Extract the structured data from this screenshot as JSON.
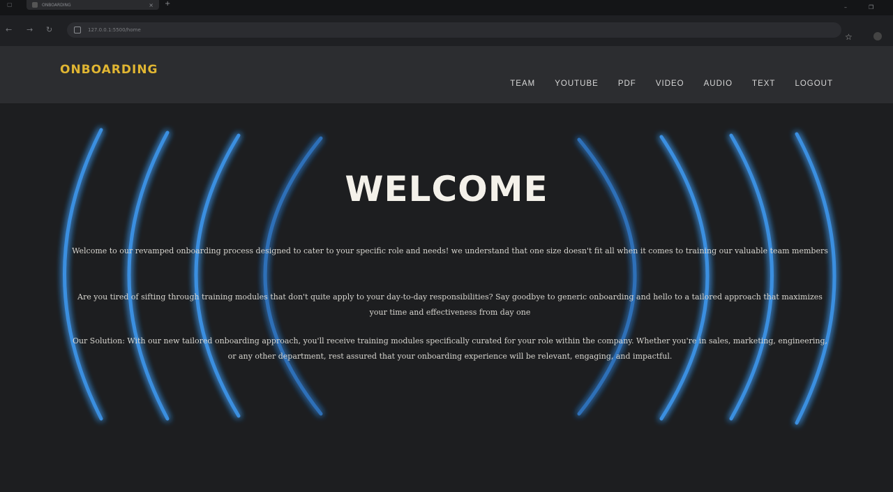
{
  "browser": {
    "tab_title": "ONBOARDING",
    "url": "127.0.0.1:5500/home",
    "new_tab": "+",
    "tab_close": "×"
  },
  "site": {
    "logo": "ONBOARDING",
    "nav": [
      "TEAM",
      "YOUTUBE",
      "PDF",
      "VIDEO",
      "AUDIO",
      "TEXT",
      "LOGOUT"
    ]
  },
  "hero": {
    "title": "WELCOME",
    "paragraphs": [
      "Welcome to our revamped onboarding process designed to cater to your specific role and needs! we understand that one size doesn't fit all when it comes to training our valuable team members",
      "Are you tired of sifting through training modules that don't quite apply to your day-to-day responsibilities? Say goodbye to generic onboarding and hello to a tailored approach that maximizes your time and effectiveness from day one",
      "Our Solution: With our new tailored onboarding approach, you'll receive training modules specifically curated for your role within the company. Whether you're in sales, marketing, engineering, or any other department, rest assured that your onboarding experience will be relevant, engaging, and impactful."
    ]
  },
  "colors": {
    "logo": "#e1b632",
    "arc_glow": "#3a8fe0",
    "background": "#1d1e20"
  },
  "icons": {
    "back": "back-arrow-icon",
    "forward": "forward-arrow-icon",
    "reload": "reload-icon",
    "star": "bookmark-star-icon"
  }
}
